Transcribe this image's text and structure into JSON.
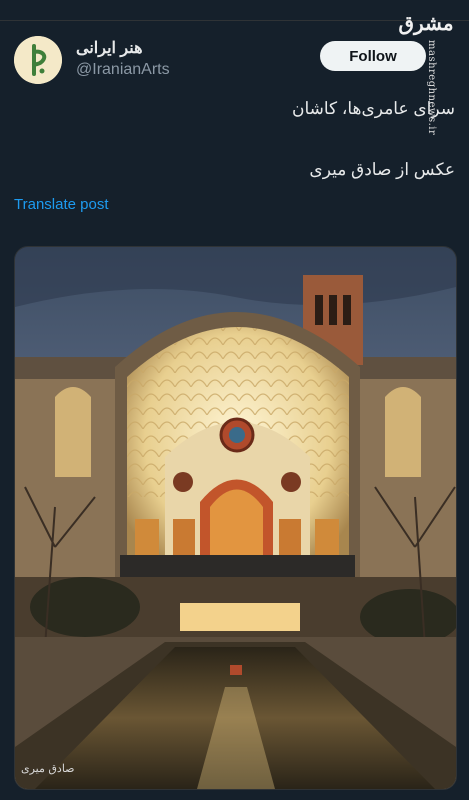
{
  "author": {
    "display_name": "هنر ایرانی",
    "handle": "@IranianArts",
    "avatar_icon": "calligraphy-logo-icon"
  },
  "follow_label": "Follow",
  "watermark": {
    "logo_text": "مشرق",
    "site_text": "mashreghnews.ir"
  },
  "tweet": {
    "line1": "سرای عامری‌ها، کاشان",
    "line2": "عکس از صادق میری"
  },
  "translate_label": "Translate post",
  "photo": {
    "subject": "courtyard-building-photo",
    "signature_text": "صادق میری"
  },
  "colors": {
    "background": "#15202b",
    "link": "#1d9bf0",
    "button": "#eff3f4"
  }
}
